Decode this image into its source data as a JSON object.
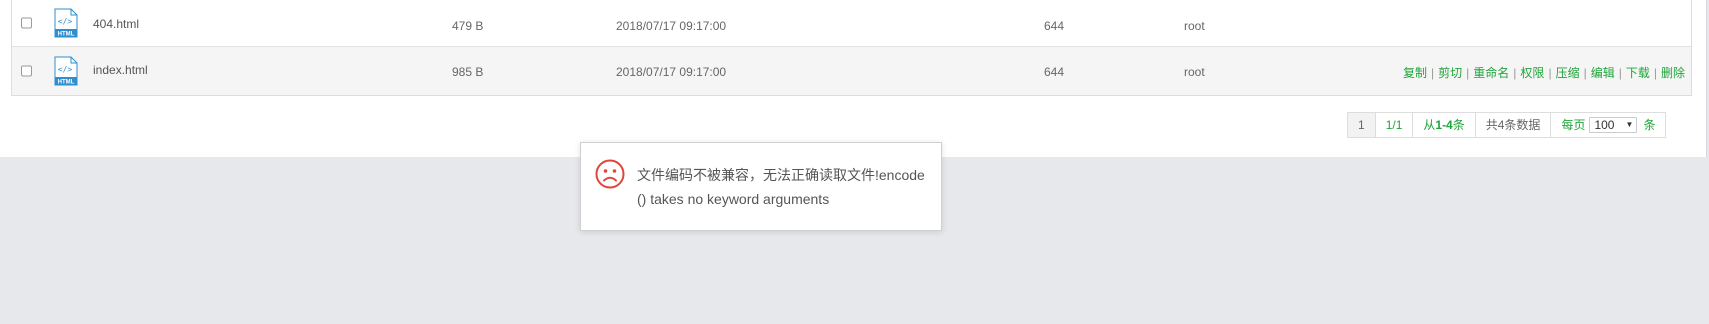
{
  "files": [
    {
      "name": "404.html",
      "size": "479 B",
      "modified": "2018/07/17 09:17:00",
      "permission": "644",
      "owner": "root",
      "icon": "html-file-icon",
      "icon_label": "HTML"
    },
    {
      "name": "index.html",
      "size": "985 B",
      "modified": "2018/07/17 09:17:00",
      "permission": "644",
      "owner": "root",
      "icon": "html-file-icon",
      "icon_label": "HTML"
    }
  ],
  "row_actions": {
    "copy": "复制",
    "cut": "剪切",
    "rename": "重命名",
    "permission": "权限",
    "compress": "压缩",
    "edit": "编辑",
    "download": "下载",
    "delete": "删除",
    "separator": "|"
  },
  "pagination": {
    "current_page": "1",
    "page_of_total": "1/1",
    "range_prefix": "从",
    "range": "1-4",
    "range_suffix": "条",
    "total": "共4条数据",
    "per_page_label": "每页",
    "per_page_value": "100",
    "per_page_unit": "条"
  },
  "error_toast": {
    "icon": "sad-face-icon",
    "message": "文件编码不被兼容，无法正确读取文件!encode() takes no keyword arguments"
  },
  "colors": {
    "accent": "#20a53a",
    "error": "#e0443b",
    "file_icon": "#2d8fcf"
  }
}
